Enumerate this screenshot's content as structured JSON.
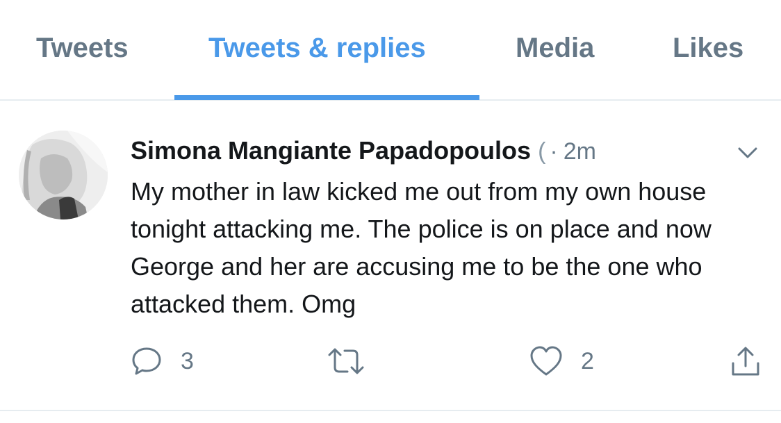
{
  "tabs": [
    {
      "label": "Tweets",
      "active": false
    },
    {
      "label": "Tweets & replies",
      "active": true
    },
    {
      "label": "Media",
      "active": false
    },
    {
      "label": "Likes",
      "active": false
    }
  ],
  "tweet": {
    "author_name": "Simona Mangiante Papadopoulos",
    "handle_fragment": "(",
    "separator": "·",
    "time": "2m",
    "text": "My mother in law kicked me out from my own house tonight attacking me. The police is on place and now George and her are accusing me to be the one who attacked them. Omg",
    "reply_count": "3",
    "retweet_count": "",
    "like_count": "2"
  },
  "icons": {
    "reply": "reply-icon",
    "retweet": "retweet-icon",
    "like": "heart-icon",
    "share": "share-icon",
    "more": "chevron-down-icon"
  },
  "colors": {
    "accent": "#4a99e9",
    "muted": "#657786",
    "text": "#14171a",
    "border": "#e6ecf0"
  }
}
